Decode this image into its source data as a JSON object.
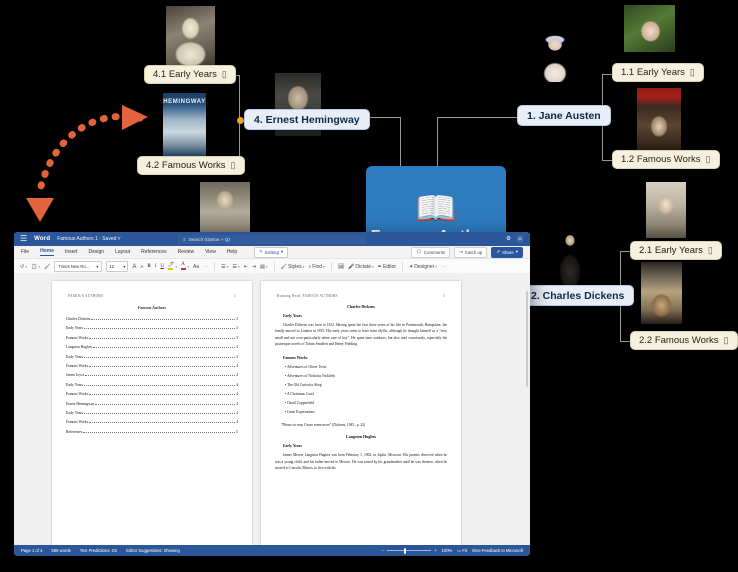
{
  "mindmap": {
    "central": {
      "title": "Famous Authors",
      "icon": "open-book-icon",
      "color": "#2d7cc0"
    },
    "branches": [
      {
        "id": "austen",
        "label": "1. Jane Austen"
      },
      {
        "id": "dickens",
        "label": "2. Charles Dickens"
      },
      {
        "id": "hemingway",
        "label": "4. Ernest Hemingway"
      }
    ],
    "subtopics": [
      {
        "id": "austen-early",
        "label": "1.1 Early Years",
        "clip": "attachment-icon"
      },
      {
        "id": "austen-works",
        "label": "1.2 Famous Works",
        "clip": "attachment-icon"
      },
      {
        "id": "dickens-early",
        "label": "2.1 Early Years",
        "clip": "attachment-icon"
      },
      {
        "id": "dickens-works",
        "label": "2.2 Famous Works",
        "clip": "attachment-icon"
      },
      {
        "id": "hemingway-early",
        "label": "4.1 Early Years",
        "clip": "attachment-icon"
      },
      {
        "id": "hemingway-works",
        "label": "4.2 Famous Works",
        "clip": "attachment-icon"
      }
    ],
    "annotation": {
      "type": "dotted-curved-arrow",
      "color": "#e2643c"
    }
  },
  "word": {
    "titlebar": {
      "app_name": "Word",
      "document": "Famous Authors 1 · Saved ˅",
      "search_placeholder": "Search (Option + Q)",
      "settings_icon": "gear-icon",
      "account_icon": "account-avatar-icon"
    },
    "tabs": [
      {
        "label": "File",
        "active": false
      },
      {
        "label": "Home",
        "active": true
      },
      {
        "label": "Insert",
        "active": false
      },
      {
        "label": "Design",
        "active": false
      },
      {
        "label": "Layout",
        "active": false
      },
      {
        "label": "References",
        "active": false
      },
      {
        "label": "Review",
        "active": false
      },
      {
        "label": "View",
        "active": false
      },
      {
        "label": "Help",
        "active": false
      }
    ],
    "editing_mode": "Editing",
    "header_actions": [
      {
        "label": "Comments",
        "icon": "comment-icon",
        "primary": false
      },
      {
        "label": "Catch up",
        "icon": "catchup-icon",
        "primary": false
      },
      {
        "label": "Share",
        "icon": "share-icon",
        "primary": true
      }
    ],
    "ribbon": {
      "undo": "↺",
      "paste": "clipboard-icon",
      "format_painter": "format-painter-icon",
      "font_name": "Times New Ro...",
      "font_size": "12",
      "grow_font": "A",
      "shrink_font": "A",
      "bold": "B",
      "italic": "I",
      "underline": "U",
      "highlight_color": "#f2c300",
      "font_color": "#c0392b",
      "clear_formatting": "Aa",
      "more": "···",
      "bullets": "bullet-list-icon",
      "numbering": "numbered-list-icon",
      "decrease_indent": "decrease-indent-icon",
      "increase_indent": "increase-indent-icon",
      "align": "align-icon",
      "styles": "Styles",
      "find": "Find",
      "dictate": "Dictate",
      "editor": "Editor",
      "designer": "Designer",
      "overflow": "···"
    },
    "page1": {
      "running_head": "FAMOUS AUTHORS",
      "page_number": "1",
      "title": "Famous Authors",
      "toc": [
        {
          "entry": "Charles Dickens",
          "page": "3"
        },
        {
          "entry": "Early Years",
          "page": "3"
        },
        {
          "entry": "Famous Works",
          "page": "3"
        },
        {
          "entry": "Langston Hughes",
          "page": "3"
        },
        {
          "entry": "Early Years",
          "page": "3"
        },
        {
          "entry": "Famous Works",
          "page": "4"
        },
        {
          "entry": "James Joyce",
          "page": "4"
        },
        {
          "entry": "Early Years",
          "page": "4"
        },
        {
          "entry": "Famous Works",
          "page": "4"
        },
        {
          "entry": "Ernest Hemingway",
          "page": "4"
        },
        {
          "entry": "Early Years",
          "page": "4"
        },
        {
          "entry": "Famous Works",
          "page": "4"
        },
        {
          "entry": "References",
          "page": "5"
        }
      ]
    },
    "page2": {
      "running_head": "Running Head: FAMOUS AUTHORS",
      "page_number": "3",
      "heading": "Charles Dickens",
      "sub1": "Early Years",
      "para1": "Charles Dickens was born in 1812. Having spent the first three years of his life in Portsmouth, Hampshire, the family moved to London in 1815. His early years seem to have been idyllic, although he thought himself as a \"very small and not over-particularly taken care of boy\". He spent time outdoors, but also read voraciously, especially the picaresque novels of Tobias Smollett and Henry Fielding.",
      "sub2": "Famous Works",
      "works": [
        "• Adventures of Oliver Twist",
        "• Adventures of Nicholas Nickleby",
        "• The Old Curiosity Shop",
        "• A Christmas Carol",
        "• David Copperfield",
        "• Great Expectations"
      ],
      "quote": "\"Please sir may I have some more\" (Dickens, 1945., p. 22)",
      "heading2": "Langston Hughes",
      "sub3": "Early Years",
      "para2": "James Mercer Langston Hughes was born February 1, 1902, in Joplin, Missouri. His parents divorced when he was a young child, and his father moved to Mexico. He was raised by his grandmother until he was thirteen, when he moved to Lincoln, Illinois, to live with his"
    },
    "status": {
      "page_of": "Page 1 of 4",
      "words": "588 words",
      "text_predictions": "Text Predictions: On",
      "editor_suggestions": "Editor Suggestions: Showing",
      "zoom_out": "−",
      "zoom_in": "+",
      "zoom_level": "100%",
      "fit_label": "Fit",
      "feedback": "Give Feedback to Microsoft"
    }
  }
}
